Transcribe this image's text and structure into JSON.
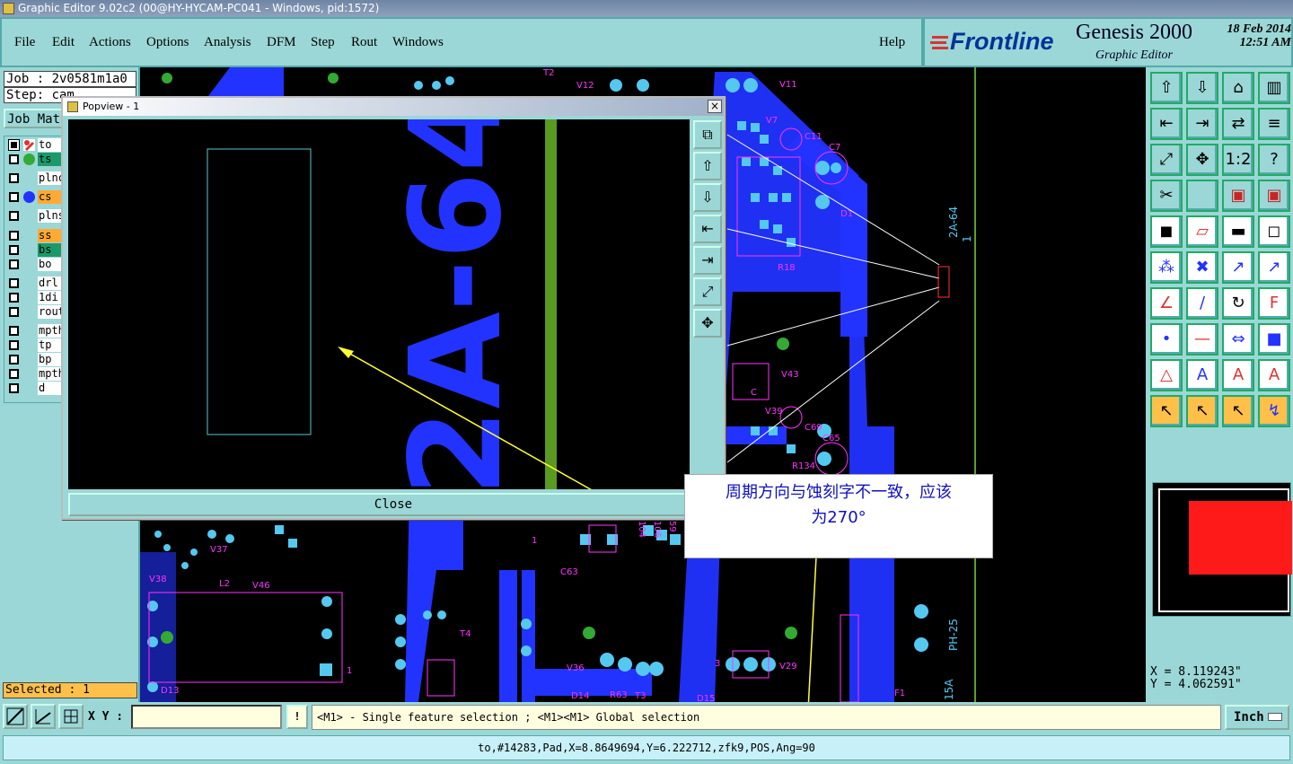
{
  "window": {
    "title": "Graphic Editor 9.02c2 (00@HY-HYCAM-PC041 - Windows, pid:1572)"
  },
  "menu": {
    "items": [
      "File",
      "Edit",
      "Actions",
      "Options",
      "Analysis",
      "DFM",
      "Step",
      "Rout",
      "Windows"
    ],
    "help": "Help"
  },
  "brand": {
    "logo": "Frontline",
    "product": "Genesis 2000",
    "subtitle": "Graphic Editor",
    "date": "18 Feb 2014",
    "time": "12:51 AM"
  },
  "job": {
    "job_label": "Job : 2v0581m1a0",
    "step_label": "Step: cam",
    "matrix_button": "Job Mat"
  },
  "layers": [
    {
      "name": "to",
      "color": "#ffffff",
      "icon": "edit-icon"
    },
    {
      "name": "ts",
      "color": "#1a9a6a",
      "dot": "#33aa33"
    },
    {
      "name": "plnc",
      "color": "#ffffff"
    },
    {
      "name": "cs",
      "color": "#ffaa33",
      "dot": "#2233ff"
    },
    {
      "name": "plns",
      "color": "#ffffff"
    },
    {
      "name": "ss",
      "color": "#ffaa33"
    },
    {
      "name": "bs",
      "color": "#1a9a6a"
    },
    {
      "name": "bo",
      "color": "#ffffff"
    },
    {
      "name": "drl",
      "color": "#ffffff"
    },
    {
      "name": "1di",
      "color": "#ffffff"
    },
    {
      "name": "rout",
      "color": "#ffffff"
    },
    {
      "name": "mpth",
      "color": "#ffffff"
    },
    {
      "name": "tp",
      "color": "#ffffff"
    },
    {
      "name": "bp",
      "color": "#ffffff"
    },
    {
      "name": "mpth",
      "color": "#ffffff"
    },
    {
      "name": "d",
      "color": "#ffffff"
    }
  ],
  "selected_label": "Selected : 1",
  "popview": {
    "title": "Popview - 1",
    "close_label": "Close",
    "text": "2A-64"
  },
  "callout": {
    "line1": "周期方向与蚀刻字不一致，应该",
    "line2": "为270°"
  },
  "pcb_labels": [
    "T2",
    "V12",
    "V11",
    "V7",
    "C11",
    "C7",
    "D1",
    "R18",
    "V43",
    "V39",
    "C69",
    "C65",
    "R134",
    "V37",
    "V38",
    "L2",
    "V46",
    "T4",
    "C63",
    "R104",
    "R106",
    "R59",
    "R107",
    "V36",
    "V29",
    "D14",
    "R63",
    "T3",
    "D15",
    "V25",
    "D13",
    "F1",
    "15A",
    "PH-25",
    "2A-64",
    "1",
    "3",
    "C",
    "C",
    "C",
    "C"
  ],
  "coords": {
    "x": "X = 8.119243\"",
    "y": "Y = 4.062591\""
  },
  "status": {
    "xy_label": "X Y :",
    "xy_value": "",
    "message": "<M1> - Single feature selection ; <M1><M1> Global selection",
    "units": "Inch",
    "excl": "!"
  },
  "feature_info": "to,#14283,Pad,X=8.8649694,Y=6.222712,zfk9,POS,Ang=90",
  "colors": {
    "accent": "#9bd7d6",
    "copper": "#2233ff",
    "pad": "#55c8f0",
    "silk": "#ff33ff",
    "green": "#33aa33"
  }
}
